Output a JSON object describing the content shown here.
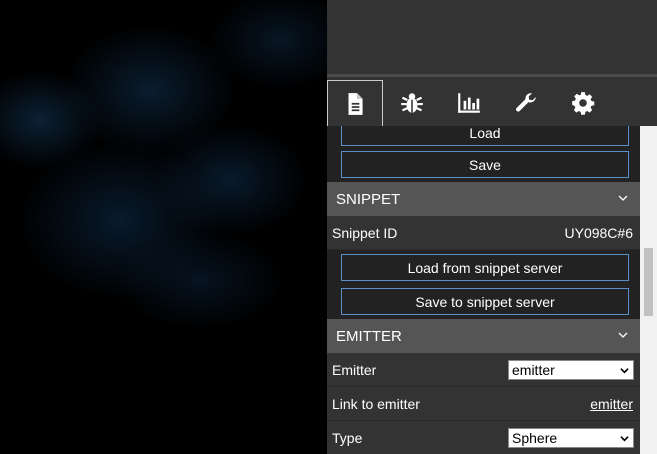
{
  "tabs": [
    {
      "icon": "document-icon"
    },
    {
      "icon": "bug-icon"
    },
    {
      "icon": "chart-icon"
    },
    {
      "icon": "wrench-icon"
    },
    {
      "icon": "gear-icon"
    }
  ],
  "file_section": {
    "load_label": "Load",
    "save_label": "Save"
  },
  "snippet_section": {
    "title": "SNIPPET",
    "snippet_id_label": "Snippet ID",
    "snippet_id_value": "UY098C#6",
    "load_button": "Load from snippet server",
    "save_button": "Save to snippet server"
  },
  "emitter_section": {
    "title": "EMITTER",
    "emitter_label": "Emitter",
    "emitter_value": "emitter",
    "link_label": "Link to emitter",
    "link_value": "emitter",
    "type_label": "Type",
    "type_value": "Sphere"
  },
  "colors": {
    "accent_border": "#5b8fc8",
    "header_bg": "#555555",
    "panel_bg": "#333333"
  }
}
